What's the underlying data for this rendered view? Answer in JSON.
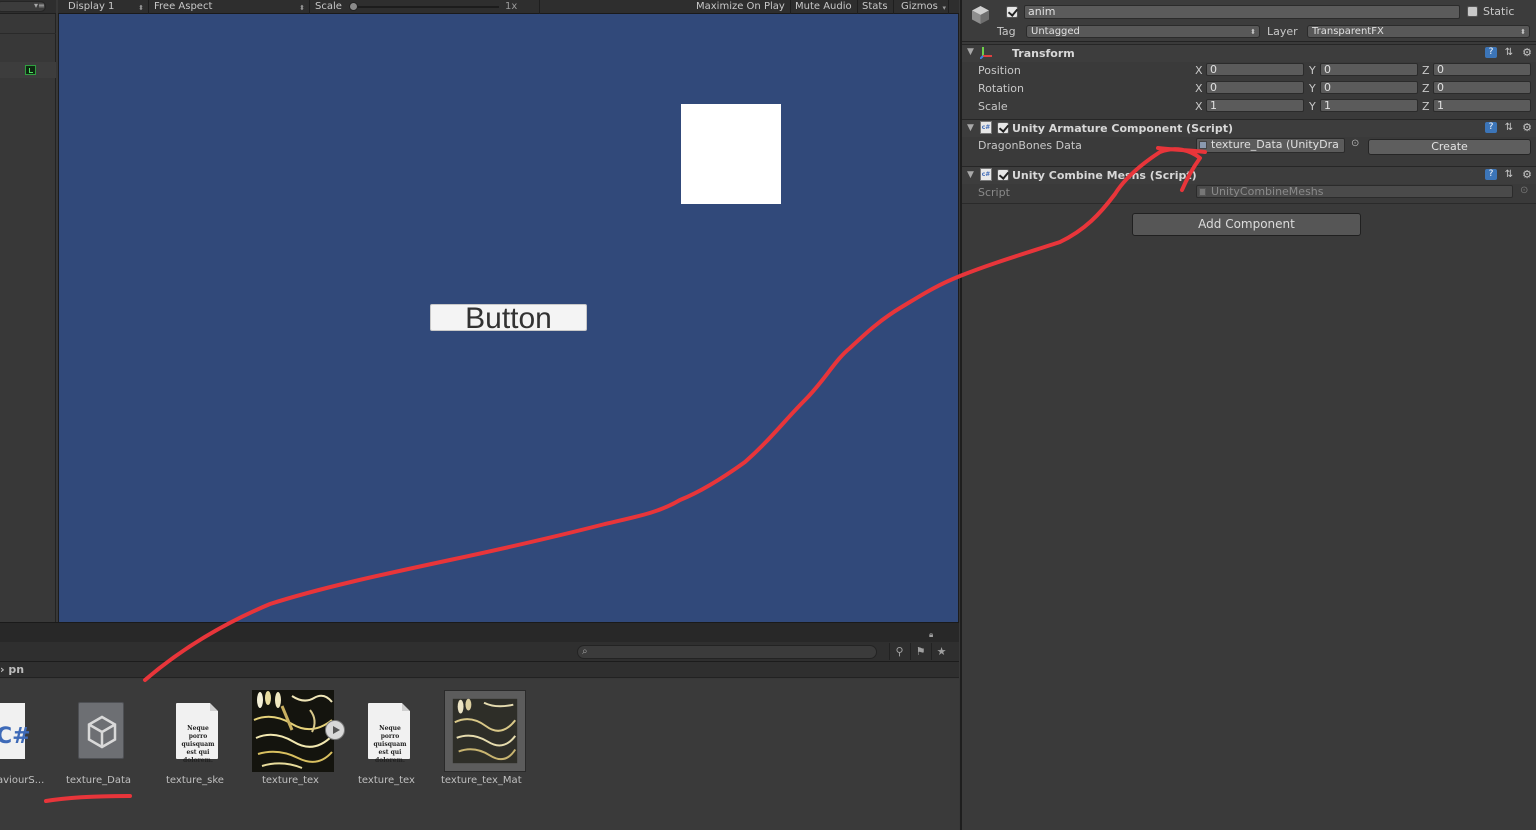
{
  "game_toolbar": {
    "display": "Display 1",
    "aspect": "Free Aspect",
    "scale_label": "Scale",
    "scale_value": "1x",
    "maximize": "Maximize On Play",
    "mute": "Mute Audio",
    "stats": "Stats",
    "gizmos": "Gizmos"
  },
  "game_view": {
    "button_label": "Button",
    "background_color": "#31497a"
  },
  "project": {
    "breadcrumb": "› pn",
    "assets": [
      {
        "label": "aviourS...",
        "icon": "csharp-script-icon"
      },
      {
        "label": "texture_Data",
        "icon": "unity-asset-icon"
      },
      {
        "label": "texture_ske",
        "icon": "text-document-icon"
      },
      {
        "label": "texture_tex",
        "icon": "texture-thumbnail"
      },
      {
        "label": "texture_tex",
        "icon": "text-document-icon"
      },
      {
        "label": "texture_tex_Mat",
        "icon": "material-thumbnail"
      }
    ],
    "doc_preview_text": "Neque porro quisquam est qui dolorem.",
    "cs_glyph": "C#"
  },
  "inspector": {
    "object_name": "anim",
    "static_label": "Static",
    "tag_label": "Tag",
    "tag_value": "Untagged",
    "layer_label": "Layer",
    "layer_value": "TransparentFX",
    "transform": {
      "title": "Transform",
      "rows": [
        {
          "label": "Position",
          "x": "0",
          "y": "0",
          "z": "0"
        },
        {
          "label": "Rotation",
          "x": "0",
          "y": "0",
          "z": "0"
        },
        {
          "label": "Scale",
          "x": "1",
          "y": "1",
          "z": "1"
        }
      ]
    },
    "armature": {
      "title": "Unity Armature Component (Script)",
      "field_label": "DragonBones Data",
      "field_value": "texture_Data (UnityDra",
      "create_label": "Create"
    },
    "combine": {
      "title": "Unity Combine Meshs (Script)",
      "script_label": "Script",
      "script_value": "UnityCombineMeshs"
    },
    "add_component": "Add Component",
    "axis_x": "X",
    "axis_y": "Y",
    "axis_z": "Z"
  },
  "annotation": {
    "color": "#e8353a"
  }
}
